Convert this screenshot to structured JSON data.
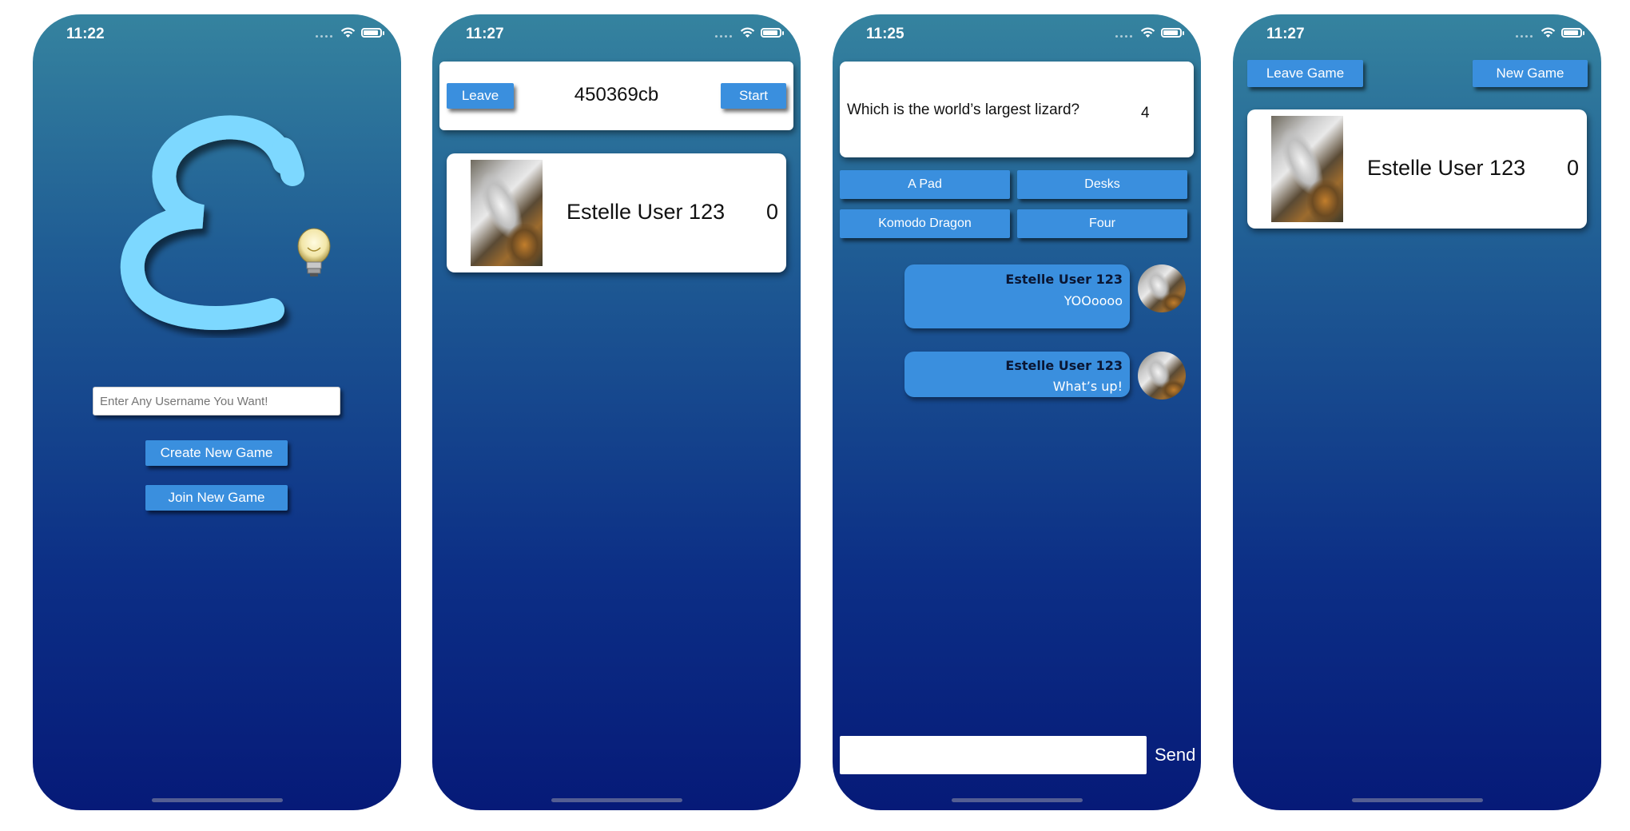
{
  "screens": [
    {
      "time": "11:22",
      "username_placeholder": "Enter Any Username You Want!",
      "create_label": "Create New Game",
      "join_label": "Join New Game"
    },
    {
      "time": "11:27",
      "leave_label": "Leave",
      "game_code": "450369cb",
      "start_label": "Start",
      "player_name": "Estelle User 123",
      "player_score": "0"
    },
    {
      "time": "11:25",
      "question": "Which is the world’s largest lizard?",
      "timer": "4",
      "answers": [
        "A Pad",
        "Desks",
        "Komodo Dragon",
        "Four"
      ],
      "messages": [
        {
          "sender": "Estelle User 123",
          "text": "YOOoooo"
        },
        {
          "sender": "Estelle User 123",
          "text": "What’s up!"
        }
      ],
      "send_label": "Send"
    },
    {
      "time": "11:27",
      "leave_label": "Leave Game",
      "new_game_label": "New Game",
      "player_name": "Estelle User 123",
      "player_score": "0"
    }
  ],
  "colors": {
    "accent": "#3a8fde",
    "logo": "#7dd8ff",
    "gradient_top": "#35839f",
    "gradient_bottom": "#061a78"
  }
}
